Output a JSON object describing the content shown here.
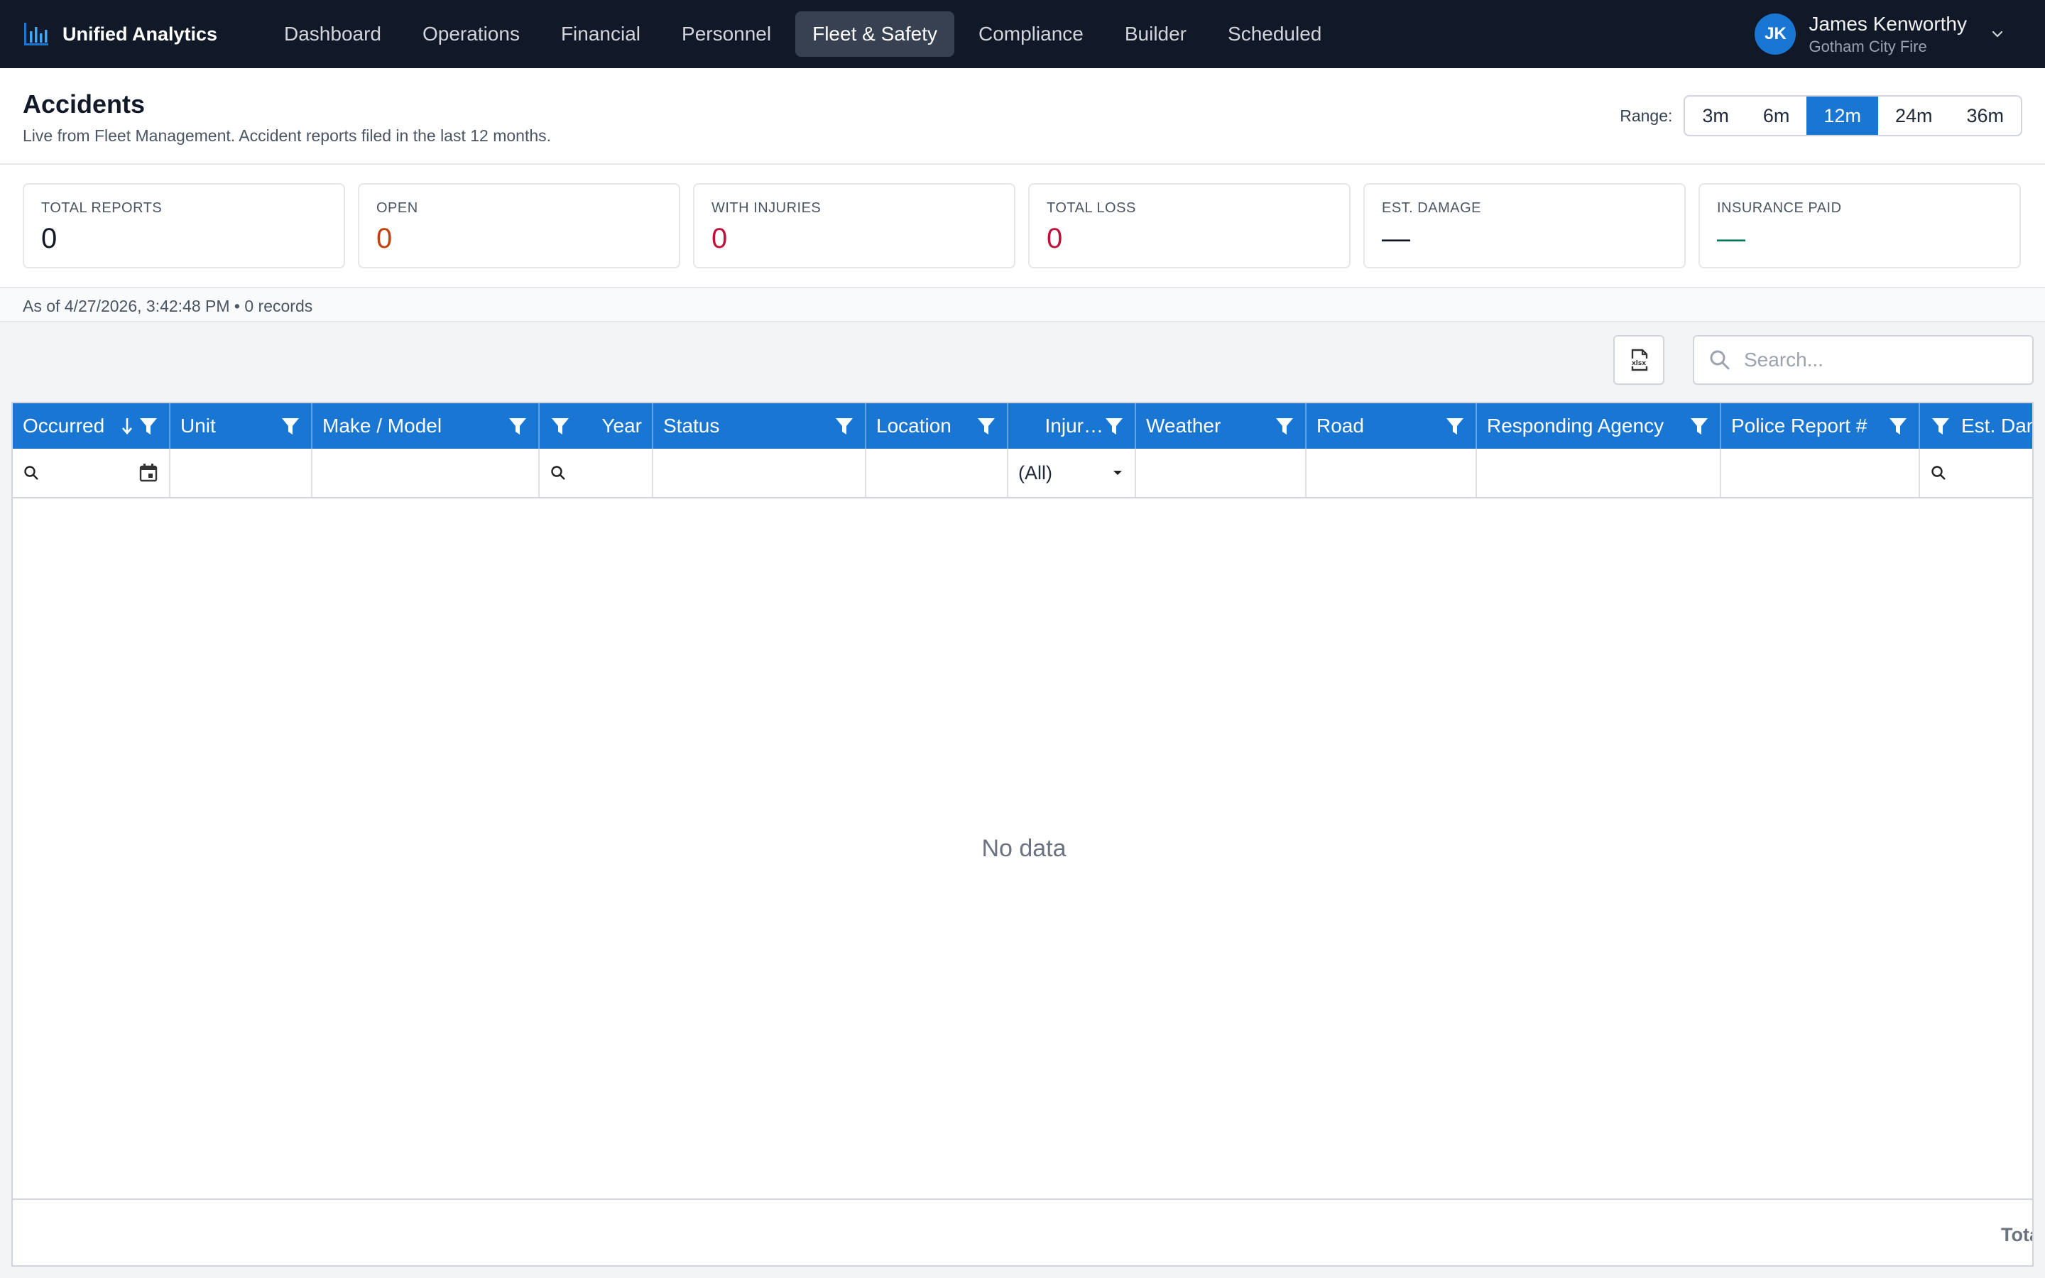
{
  "app": {
    "brand": "Unified Analytics",
    "nav": [
      "Dashboard",
      "Operations",
      "Financial",
      "Personnel",
      "Fleet & Safety",
      "Compliance",
      "Builder",
      "Scheduled"
    ],
    "active_nav": "Fleet & Safety",
    "user": {
      "initials": "JK",
      "name": "James Kenworthy",
      "org": "Gotham City Fire"
    }
  },
  "page": {
    "title": "Accidents",
    "subtitle": "Live from Fleet Management. Accident reports filed in the last 12 months.",
    "range_label": "Range:",
    "ranges": [
      "3m",
      "6m",
      "12m",
      "24m",
      "36m"
    ],
    "active_range": "12m"
  },
  "kpis": [
    {
      "label": "TOTAL REPORTS",
      "value": "0"
    },
    {
      "label": "OPEN",
      "value": "0"
    },
    {
      "label": "WITH INJURIES",
      "value": "0"
    },
    {
      "label": "TOTAL LOSS",
      "value": "0"
    },
    {
      "label": "EST. DAMAGE",
      "value": "—"
    },
    {
      "label": "INSURANCE PAID",
      "value": "—"
    }
  ],
  "asof": "As of 4/27/2026, 3:42:48 PM • 0 records",
  "toolbar": {
    "search_placeholder": "Search...",
    "export_icon": "xlsx-export-icon"
  },
  "grid": {
    "columns": [
      "Occurred",
      "Unit",
      "Make / Model",
      "Year",
      "Status",
      "Location",
      "Injur…",
      "Weather",
      "Road",
      "Responding Agency",
      "Police Report #",
      "Est. Damage"
    ],
    "injuries_filter": "(All)",
    "empty_text": "No data",
    "footer_total": "Total"
  },
  "colors": {
    "nav_bg": "#111827",
    "accent": "#1976d2",
    "open": "#c2410c",
    "danger": "#be123c",
    "money": "#047857"
  }
}
